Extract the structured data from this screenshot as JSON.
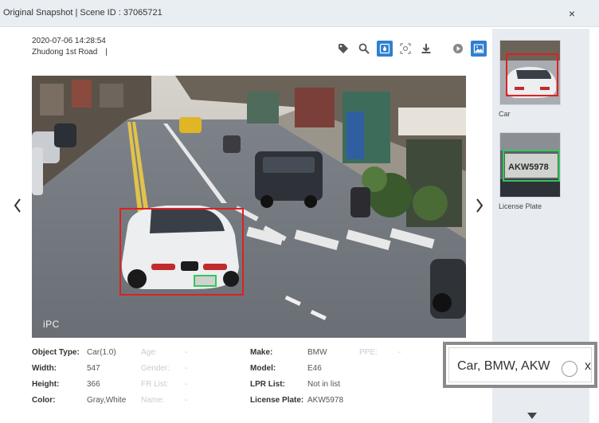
{
  "window": {
    "title": "Original Snapshot | Scene ID : 37065721",
    "close_label": "×"
  },
  "snapshot": {
    "datetime": "2020-07-06 14:28:54",
    "location": "Zhudong 1st Road",
    "separator": "|",
    "overlay_label": "iPC"
  },
  "toolbar": {
    "icons": [
      "tag-icon",
      "search-icon",
      "color-drop-icon",
      "target-icon",
      "download-icon",
      "play-icon",
      "image-icon",
      "location-pin-icon",
      "layout-icon"
    ]
  },
  "thumbnails": [
    {
      "label": "Car"
    },
    {
      "label": "License Plate"
    }
  ],
  "details": {
    "object_type": {
      "label": "Object Type:",
      "value": "Car(1.0)"
    },
    "width": {
      "label": "Width:",
      "value": "547"
    },
    "height": {
      "label": "Height:",
      "value": "366"
    },
    "color": {
      "label": "Color:",
      "value": "Gray,White"
    },
    "age": {
      "label": "Age:",
      "value": "-"
    },
    "gender": {
      "label": "Gender:",
      "value": "-"
    },
    "fr_list": {
      "label": "FR List:",
      "value": "-"
    },
    "name": {
      "label": "Name:",
      "value": "-"
    },
    "make": {
      "label": "Make:",
      "value": "BMW"
    },
    "model": {
      "label": "Model:",
      "value": "E46"
    },
    "lpr_list": {
      "label": "LPR List:",
      "value": "Not in list"
    },
    "license_plate": {
      "label": "License Plate:",
      "value": "AKW5978"
    },
    "ppe": {
      "label": "PPE:",
      "value": "-"
    }
  },
  "search": {
    "value": "Car, BMW, AKW",
    "clear_label": "x"
  },
  "colors": {
    "accent": "#2f7fd0",
    "car_box": "#e02020",
    "plate_box": "#34c759"
  }
}
